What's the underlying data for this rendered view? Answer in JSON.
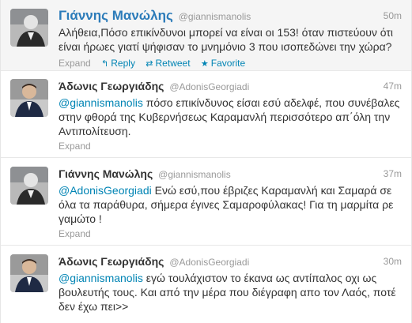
{
  "tweets": [
    {
      "fullname": "Γιάννης Μανώλης",
      "username": "@giannismanolis",
      "time": "50m",
      "text": "Αλήθεια,Πόσο επικίνδυνοι μπορεί να είναι οι 153! όταν πιστεύουν ότι είναι ήρωες γιατί ψήφισαν το μνημόνιο 3 που ισοπεδώνει την χώρα?",
      "actions": {
        "expand": "Expand",
        "reply": "Reply",
        "retweet": "Retweet",
        "favorite": "Favorite"
      }
    },
    {
      "fullname": "Άδωνις Γεωργιάδης",
      "username": "@AdonisGeorgiadi",
      "time": "47m",
      "mention": "@giannismanolis",
      "text": " πόσο επικίνδυνος είσαι εσύ αδελφέ, που συνέβαλες στην φθορά της Κυβερνήσεως Καραμανλή περισσότερο απ΄όλη την Αντιπολίτευση.",
      "actions": {
        "expand": "Expand"
      }
    },
    {
      "fullname": "Γιάννης Μανώλης",
      "username": "@giannismanolis",
      "time": "37m",
      "mention": "@AdonisGeorgiadi",
      "text": " Ενώ εσύ,που έβριζες Καραμανλή και Σαμαρά σε όλα τα παράθυρα, σήμερα έγινες Σαμαροφύλακας! Για τη μαρμίτα ρε γαμώτο !",
      "actions": {
        "expand": "Expand"
      }
    },
    {
      "fullname": "Άδωνις Γεωργιάδης",
      "username": "@AdonisGeorgiadi",
      "time": "30m",
      "mention": "@giannismanolis",
      "text": " εγώ τουλάχιστον το έκανα ως αντίπαλος οχι ως βουλευτής τους. Και από την μέρα που διέγραφη απο τον Λαός, ποτέ δεν έχω πει>>"
    }
  ],
  "icons": {
    "reply": "reply-arrow",
    "retweet": "retweet-arrows",
    "favorite": "star"
  },
  "colors": {
    "link": "#0084b4",
    "name_link": "#2b7bb9",
    "meta": "#999999",
    "text": "#333333",
    "highlight_bg": "#f5f5f5"
  }
}
